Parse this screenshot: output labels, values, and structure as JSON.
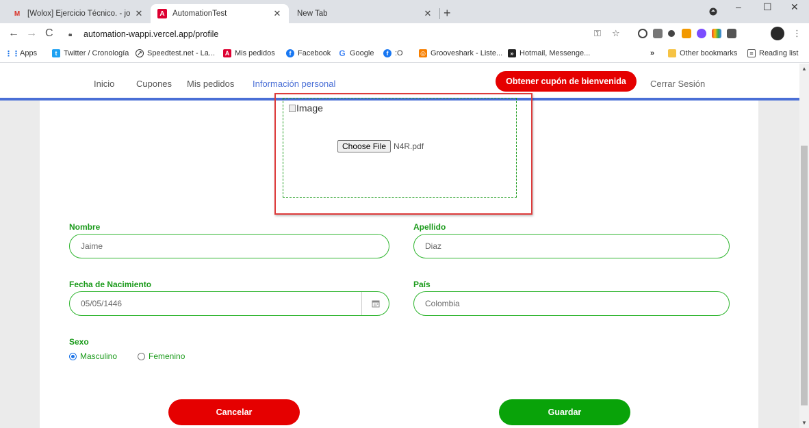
{
  "browser": {
    "tabs": [
      {
        "title": "[Wolox] Ejercicio Técnico. - johnd",
        "favicon": "gmail-icon"
      },
      {
        "title": "AutomationTest",
        "favicon": "angular-icon"
      },
      {
        "title": "New Tab",
        "favicon": ""
      }
    ],
    "url": "automation-wappi.vercel.app/profile",
    "bookmarks": [
      {
        "label": "Apps",
        "icon": "apps-grid-icon"
      },
      {
        "label": "Twitter / Cronología",
        "icon": "twitter-icon"
      },
      {
        "label": "Speedtest.net - La...",
        "icon": "speedtest-icon"
      },
      {
        "label": "Mis pedidos",
        "icon": "angular-icon"
      },
      {
        "label": "Facebook",
        "icon": "facebook-icon"
      },
      {
        "label": "Google",
        "icon": "google-icon"
      },
      {
        "label": ":O",
        "icon": "facebook-icon"
      },
      {
        "label": "Grooveshark - Liste...",
        "icon": "grooveshark-icon"
      },
      {
        "label": "Hotmail, Messenge...",
        "icon": "msn-icon"
      },
      {
        "label": "Other bookmarks",
        "icon": "folder-icon"
      },
      {
        "label": "Reading list",
        "icon": "reading-list-icon"
      }
    ],
    "overflow_label": "»"
  },
  "nav": {
    "links": [
      "Inicio",
      "Cupones",
      "Mis pedidos",
      "Información personal"
    ],
    "cta": "Obtener cupón de bienvenida",
    "logout": "Cerrar Sesión"
  },
  "upload": {
    "image_alt": "Image",
    "choose_label": "Choose File",
    "file_name": "N4R.pdf"
  },
  "form": {
    "nombre_label": "Nombre",
    "nombre_value": "Jaime",
    "apellido_label": "Apellido",
    "apellido_value": "Diaz",
    "fecha_label": "Fecha de Nacimiento",
    "fecha_value": "05/05/1446",
    "pais_label": "País",
    "pais_value": "Colombia",
    "sexo_label": "Sexo",
    "sexo_options": [
      "Masculino",
      "Femenino"
    ],
    "sexo_selected": "Masculino"
  },
  "actions": {
    "cancel": "Cancelar",
    "save": "Guardar"
  },
  "colors": {
    "brand_blue": "#4a6fd6",
    "cta_red": "#e50000",
    "save_green": "#09a309",
    "field_green": "#2fb52f",
    "highlight_red": "#dd3b3b"
  }
}
